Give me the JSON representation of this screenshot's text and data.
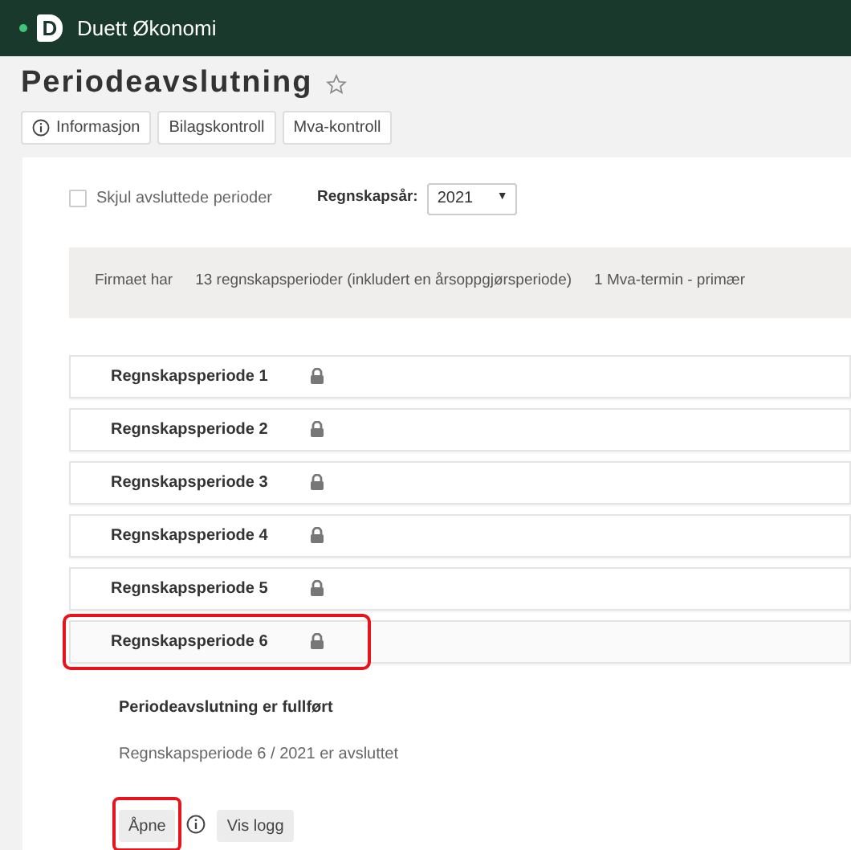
{
  "app": {
    "name": "Duett Økonomi",
    "logo_letter": "D"
  },
  "page": {
    "title": "Periodeavslutning",
    "favorite": false
  },
  "tabs": [
    {
      "label": "Informasjon",
      "kind": "info"
    },
    {
      "label": "Bilagskontroll",
      "kind": "plain"
    },
    {
      "label": "Mva-kontroll",
      "kind": "plain"
    }
  ],
  "filters": {
    "hide_closed": {
      "label": "Skjul avsluttede perioder",
      "checked": false
    },
    "year": {
      "label": "Regnskapsår:",
      "value": "2021",
      "caret": "▼"
    }
  },
  "summary": [
    "Firmaet har",
    "13 regnskapsperioder (inkludert en årsoppgjørsperiode)",
    "1 Mva-termin - primær"
  ],
  "periods": [
    {
      "label": "Regnskapsperiode 1",
      "locked": true,
      "expanded": false,
      "highlighted": false
    },
    {
      "label": "Regnskapsperiode 2",
      "locked": true,
      "expanded": false,
      "highlighted": false
    },
    {
      "label": "Regnskapsperiode 3",
      "locked": true,
      "expanded": false,
      "highlighted": false
    },
    {
      "label": "Regnskapsperiode 4",
      "locked": true,
      "expanded": false,
      "highlighted": false
    },
    {
      "label": "Regnskapsperiode 5",
      "locked": true,
      "expanded": false,
      "highlighted": false
    },
    {
      "label": "Regnskapsperiode 6",
      "locked": true,
      "expanded": true,
      "highlighted": true
    }
  ],
  "detail": {
    "heading": "Periodeavslutning er fullført",
    "message": "Regnskapsperiode 6 / 2021 er avsluttet",
    "buttons": [
      {
        "label": "Åpne",
        "kind": "button",
        "highlighted": true
      },
      {
        "kind": "info"
      },
      {
        "label": "Vis logg",
        "kind": "button",
        "highlighted": false
      }
    ]
  }
}
